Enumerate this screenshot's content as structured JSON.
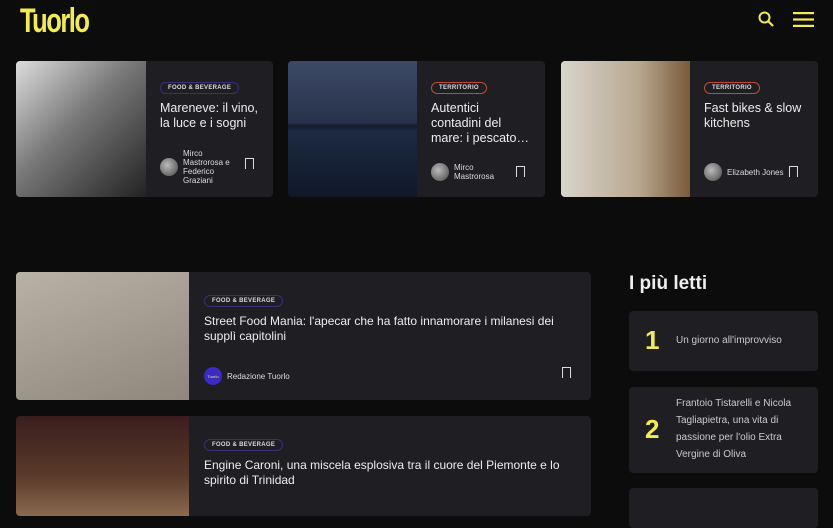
{
  "header": {
    "logo": "Tuorlo",
    "search_icon": "search-icon",
    "menu_icon": "menu-icon",
    "accent": "#f2ec4f"
  },
  "top_cards": [
    {
      "category": "FOOD & BEVERAGE",
      "title": "Mareneve: il vino, la luce e i sogni",
      "author": "Mirco Mastrorosa e Federico Graziani"
    },
    {
      "category": "TERRITORIO",
      "title": "Autentici contadini del mare: i pescato…",
      "author": "Mirco Mastrorosa"
    },
    {
      "category": "TERRITORIO",
      "title": "Fast bikes & slow kitchens",
      "author": "Elizabeth Jones"
    }
  ],
  "wide_cards": [
    {
      "category": "FOOD & BEVERAGE",
      "title": "Street Food Mania: l'apecar che ha fatto innamorare i milanesi dei supplì capitolini",
      "author": "Redazione Tuorlo",
      "avatar_text": "Tuorlo"
    },
    {
      "category": "FOOD & BEVERAGE",
      "title": "Engine Caroni, una miscela esplosiva tra il cuore del Piemonte e lo spirito di Trinidad"
    }
  ],
  "sidebar": {
    "title": "I più letti",
    "items": [
      {
        "rank": "1",
        "title": "Un giorno all'improvviso"
      },
      {
        "rank": "2",
        "title": "Frantoio Tistarelli e Nicola Tagliapietra, una vita di passione per l'olio Extra Vergine di Oliva"
      }
    ]
  }
}
